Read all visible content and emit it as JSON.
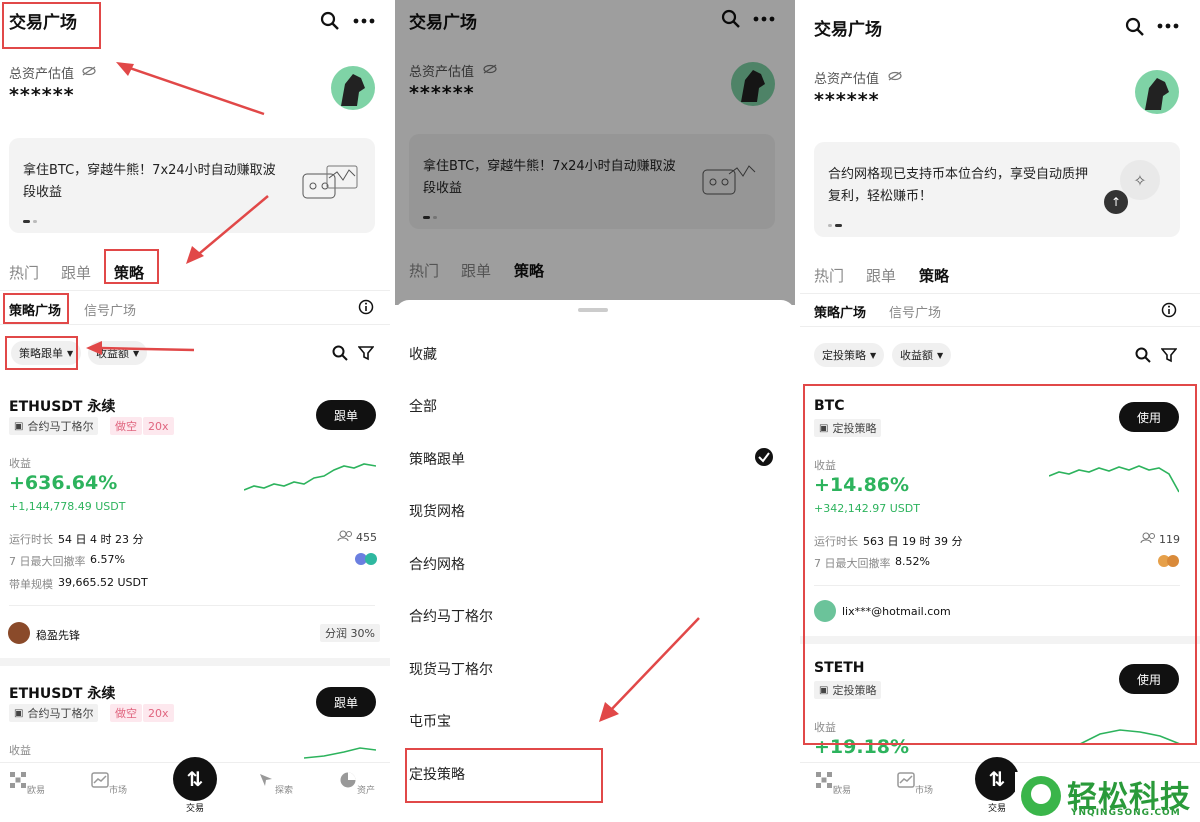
{
  "header": {
    "title": "交易广场"
  },
  "assets": {
    "label": "总资产估值",
    "value": "******"
  },
  "banner1": {
    "text": "拿住BTC，穿越牛熊！7x24小时自动赚取波段收益"
  },
  "banner3": {
    "text": "合约网格现已支持币本位合约，享受自动质押复利，轻松赚币！"
  },
  "tabs": [
    "热门",
    "跟单",
    "策略"
  ],
  "subtabs": [
    "策略广场",
    "信号广场"
  ],
  "filters1": {
    "primary": "策略跟单",
    "secondary": "收益额"
  },
  "filters3": {
    "primary": "定投策略",
    "secondary": "收益额"
  },
  "panel1": {
    "card1": {
      "title": "ETHUSDT 永续",
      "tag": "合约马丁格尔",
      "side": "做空",
      "leverage": "20x",
      "button": "跟单",
      "profit_label": "收益",
      "profit_pct": "+636.64%",
      "profit_amt": "+1,144,778.49 USDT",
      "run_label": "运行时长",
      "run_value": "54 日 4 时 23 分",
      "followers": "455",
      "dd_label": "7 日最大回撤率",
      "dd_value": "6.57%",
      "scale_label": "带单规模",
      "scale_value": "39,665.52 USDT",
      "trader": "稳盈先锋",
      "share": "分润 30%"
    },
    "card2": {
      "title": "ETHUSDT 永续",
      "tag": "合约马丁格尔",
      "side": "做空",
      "leverage": "20x",
      "button": "跟单",
      "profit_label": "收益"
    }
  },
  "sheet": {
    "options": [
      "收藏",
      "全部",
      "策略跟单",
      "现货网格",
      "合约网格",
      "合约马丁格尔",
      "现货马丁格尔",
      "屯币宝",
      "定投策略"
    ],
    "checked": "策略跟单"
  },
  "panel3": {
    "card1": {
      "title": "BTC",
      "tag": "定投策略",
      "button": "使用",
      "profit_label": "收益",
      "profit_pct": "+14.86%",
      "profit_amt": "+342,142.97 USDT",
      "run_label": "运行时长",
      "run_value": "563 日 19 时 39 分",
      "followers": "119",
      "dd_label": "7 日最大回撤率",
      "dd_value": "8.52%",
      "user": "lix***@hotmail.com"
    },
    "card2": {
      "title": "STETH",
      "tag": "定投策略",
      "button": "使用",
      "profit_label": "收益",
      "profit_pct": "+19.18%"
    }
  },
  "nav": [
    "欧易",
    "市场",
    "交易",
    "探索",
    "资产"
  ],
  "watermark": {
    "name": "轻松科技",
    "url": "YNQINGSONG.COM"
  },
  "colors": {
    "accent_red": "#e14848",
    "profit_green": "#2db35d",
    "dark": "#111111"
  }
}
